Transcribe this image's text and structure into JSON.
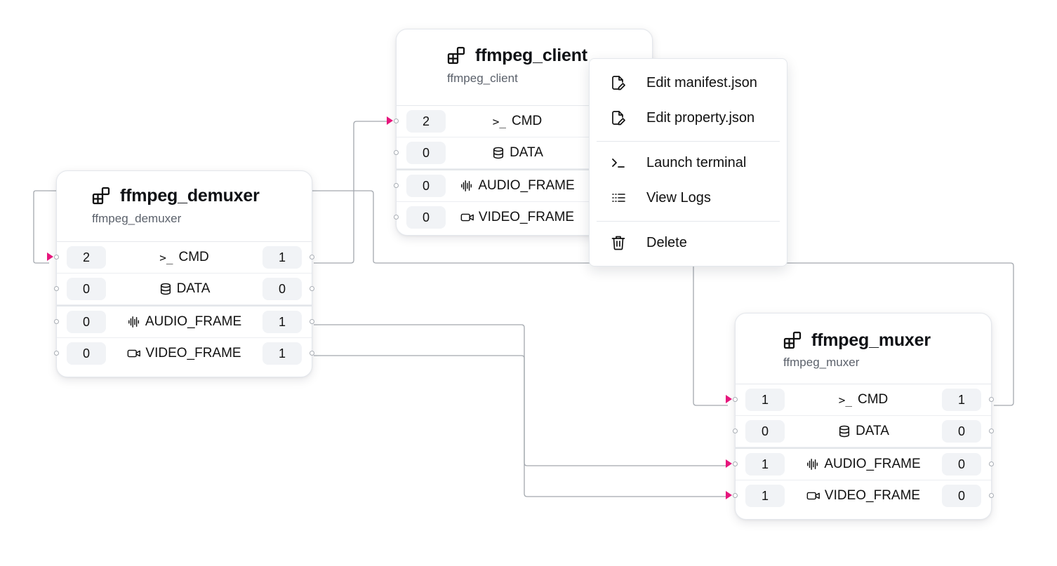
{
  "nodes": {
    "client": {
      "title": "ffmpeg_client",
      "subtitle": "ffmpeg_client",
      "rows": [
        {
          "left": "2",
          "label": "CMD",
          "right": ""
        },
        {
          "left": "0",
          "label": "DATA",
          "right": ""
        },
        {
          "left": "0",
          "label": "AUDIO_FRAME",
          "right": ""
        },
        {
          "left": "0",
          "label": "VIDEO_FRAME",
          "right": ""
        }
      ]
    },
    "demuxer": {
      "title": "ffmpeg_demuxer",
      "subtitle": "ffmpeg_demuxer",
      "rows": [
        {
          "left": "2",
          "label": "CMD",
          "right": "1"
        },
        {
          "left": "0",
          "label": "DATA",
          "right": "0"
        },
        {
          "left": "0",
          "label": "AUDIO_FRAME",
          "right": "1"
        },
        {
          "left": "0",
          "label": "VIDEO_FRAME",
          "right": "1"
        }
      ]
    },
    "muxer": {
      "title": "ffmpeg_muxer",
      "subtitle": "ffmpeg_muxer",
      "rows": [
        {
          "left": "1",
          "label": "CMD",
          "right": "1"
        },
        {
          "left": "0",
          "label": "DATA",
          "right": "0"
        },
        {
          "left": "1",
          "label": "AUDIO_FRAME",
          "right": "0"
        },
        {
          "left": "1",
          "label": "VIDEO_FRAME",
          "right": "0"
        }
      ]
    }
  },
  "row_icons": [
    "terminal-icon",
    "database-icon",
    "audio-wave-icon",
    "video-camera-icon"
  ],
  "context_menu": {
    "items": [
      {
        "label": "Edit manifest.json",
        "icon": "file-edit-icon"
      },
      {
        "label": "Edit property.json",
        "icon": "file-edit-icon"
      },
      {
        "label": "Launch terminal",
        "icon": "terminal-icon"
      },
      {
        "label": "View Logs",
        "icon": "list-icon"
      },
      {
        "label": "Delete",
        "icon": "trash-icon"
      }
    ]
  },
  "colors": {
    "accent_arrow": "#e6157c",
    "edge": "#9aa0a6",
    "pill_bg": "#f1f3f6"
  }
}
